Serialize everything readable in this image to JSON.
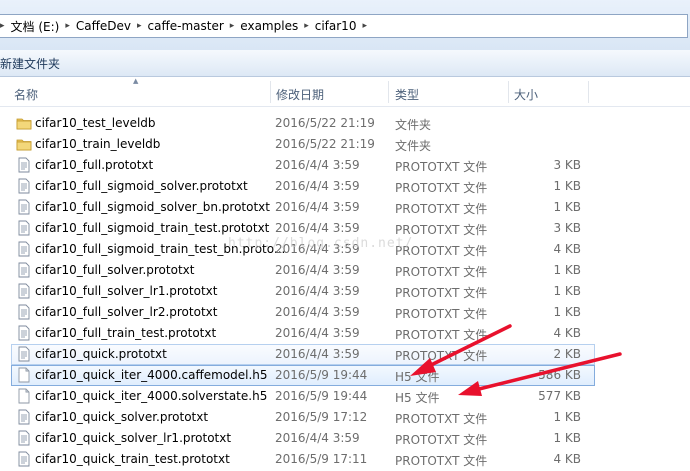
{
  "breadcrumb": [
    {
      "label": "文档 (E:)"
    },
    {
      "label": "CaffeDev"
    },
    {
      "label": "caffe-master"
    },
    {
      "label": "examples"
    },
    {
      "label": "cifar10"
    }
  ],
  "toolbar": {
    "new_folder_label": "新建文件夹"
  },
  "columns": {
    "name": "名称",
    "date": "修改日期",
    "type": "类型",
    "size": "大小"
  },
  "files": [
    {
      "name": "cifar10_test_leveldb",
      "date": "2016/5/22 21:19",
      "type": "文件夹",
      "size": "",
      "icon": "folder-icon"
    },
    {
      "name": "cifar10_train_leveldb",
      "date": "2016/5/22 21:19",
      "type": "文件夹",
      "size": "",
      "icon": "folder-icon"
    },
    {
      "name": "cifar10_full.prototxt",
      "date": "2016/4/4 3:59",
      "type": "PROTOTXT 文件",
      "size": "3 KB",
      "icon": "text-file-icon"
    },
    {
      "name": "cifar10_full_sigmoid_solver.prototxt",
      "date": "2016/4/4 3:59",
      "type": "PROTOTXT 文件",
      "size": "1 KB",
      "icon": "text-file-icon"
    },
    {
      "name": "cifar10_full_sigmoid_solver_bn.prototxt",
      "date": "2016/4/4 3:59",
      "type": "PROTOTXT 文件",
      "size": "1 KB",
      "icon": "text-file-icon"
    },
    {
      "name": "cifar10_full_sigmoid_train_test.prototxt",
      "date": "2016/4/4 3:59",
      "type": "PROTOTXT 文件",
      "size": "3 KB",
      "icon": "text-file-icon"
    },
    {
      "name": "cifar10_full_sigmoid_train_test_bn.proto...",
      "date": "2016/4/4 3:59",
      "type": "PROTOTXT 文件",
      "size": "4 KB",
      "icon": "text-file-icon"
    },
    {
      "name": "cifar10_full_solver.prototxt",
      "date": "2016/4/4 3:59",
      "type": "PROTOTXT 文件",
      "size": "1 KB",
      "icon": "text-file-icon"
    },
    {
      "name": "cifar10_full_solver_lr1.prototxt",
      "date": "2016/4/4 3:59",
      "type": "PROTOTXT 文件",
      "size": "1 KB",
      "icon": "text-file-icon"
    },
    {
      "name": "cifar10_full_solver_lr2.prototxt",
      "date": "2016/4/4 3:59",
      "type": "PROTOTXT 文件",
      "size": "1 KB",
      "icon": "text-file-icon"
    },
    {
      "name": "cifar10_full_train_test.prototxt",
      "date": "2016/4/4 3:59",
      "type": "PROTOTXT 文件",
      "size": "4 KB",
      "icon": "text-file-icon"
    },
    {
      "name": "cifar10_quick.prototxt",
      "date": "2016/4/4 3:59",
      "type": "PROTOTXT 文件",
      "size": "2 KB",
      "icon": "text-file-icon"
    },
    {
      "name": "cifar10_quick_iter_4000.caffemodel.h5",
      "date": "2016/5/9 19:44",
      "type": "H5 文件",
      "size": "586 KB",
      "icon": "blank-file-icon"
    },
    {
      "name": "cifar10_quick_iter_4000.solverstate.h5",
      "date": "2016/5/9 19:44",
      "type": "H5 文件",
      "size": "577 KB",
      "icon": "blank-file-icon"
    },
    {
      "name": "cifar10_quick_solver.prototxt",
      "date": "2016/5/9 17:12",
      "type": "PROTOTXT 文件",
      "size": "1 KB",
      "icon": "text-file-icon"
    },
    {
      "name": "cifar10_quick_solver_lr1.prototxt",
      "date": "2016/4/4 3:59",
      "type": "PROTOTXT 文件",
      "size": "1 KB",
      "icon": "text-file-icon"
    },
    {
      "name": "cifar10_quick_train_test.prototxt",
      "date": "2016/5/9 17:11",
      "type": "PROTOTXT 文件",
      "size": "4 KB",
      "icon": "text-file-icon"
    }
  ],
  "hover_row_index": 11,
  "selected_row_index": 12,
  "watermark": "http://blog.csdn.net/",
  "colors": {
    "annotation_arrow": "#e8112d",
    "selection_border": "#84acdd",
    "folder": "#e8c25a"
  }
}
